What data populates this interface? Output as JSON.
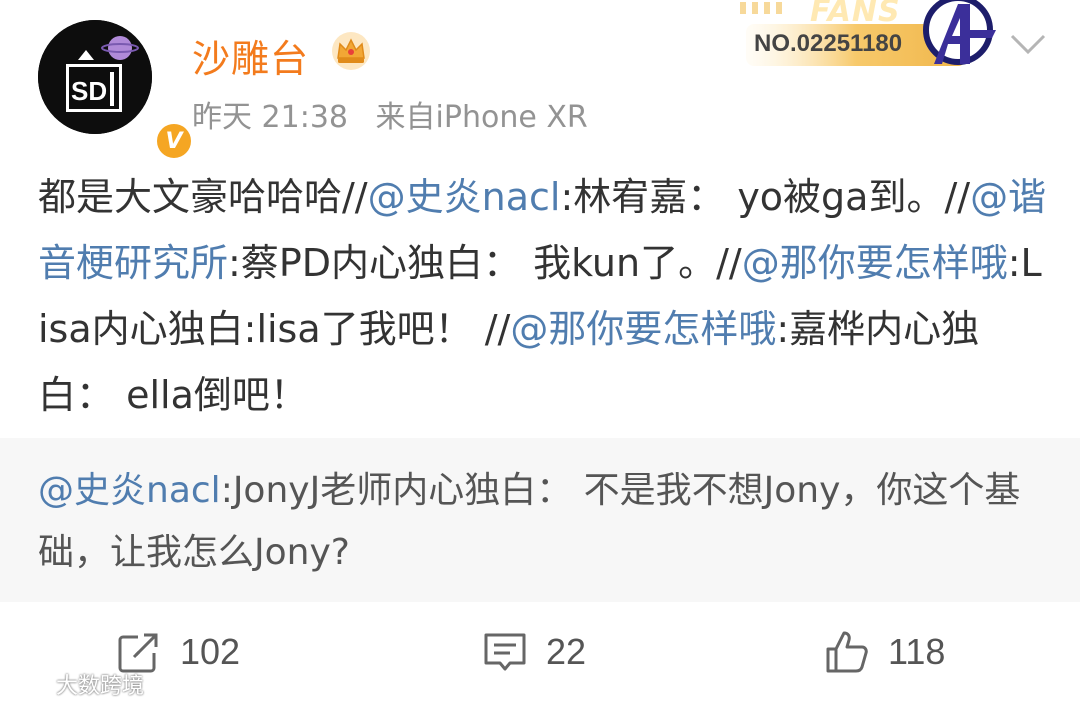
{
  "post": {
    "author": {
      "name": "沙雕台",
      "avatar_text": "SD",
      "verified_mark": "V"
    },
    "meta": {
      "time": "昨天 21:38",
      "source": "来自iPhone XR"
    },
    "fans_badge": {
      "word": "FANS",
      "number": "NO.02251180"
    },
    "body_segments": [
      {
        "text": "都是大文豪哈哈哈//",
        "mention": false
      },
      {
        "text": "@史炎nacl",
        "mention": true
      },
      {
        "text": ":林宥嘉： yo被ga到。//",
        "mention": false
      },
      {
        "text": "@谐音梗研究所",
        "mention": true
      },
      {
        "text": ":蔡PD内心独白： 我kun了。//",
        "mention": false
      },
      {
        "text": "@那你要怎样哦",
        "mention": true
      },
      {
        "text": ":Lisa内心独白:lisa了我吧！ //",
        "mention": false
      },
      {
        "text": "@那你要怎样哦",
        "mention": true
      },
      {
        "text": ":嘉桦内心独白： ella倒吧！",
        "mention": false
      }
    ],
    "quote": {
      "mention": "@史炎nacl",
      "text": ":JonyJ老师内心独白： 不是我不想Jony，你这个基础，让我怎么Jony?"
    },
    "actions": {
      "repost_count": "102",
      "comment_count": "22",
      "like_count": "118"
    },
    "icons": [
      "crown-icon",
      "avengers-icon",
      "chevron-down-icon",
      "repost-icon",
      "comment-icon",
      "like-icon"
    ],
    "colors": {
      "username": "#f37b1d",
      "mention": "#507daf",
      "meta": "#939393",
      "quote_bg": "#f7f7f7",
      "badge": "#f5a623"
    }
  },
  "watermark": {
    "text": "大数跨境"
  }
}
